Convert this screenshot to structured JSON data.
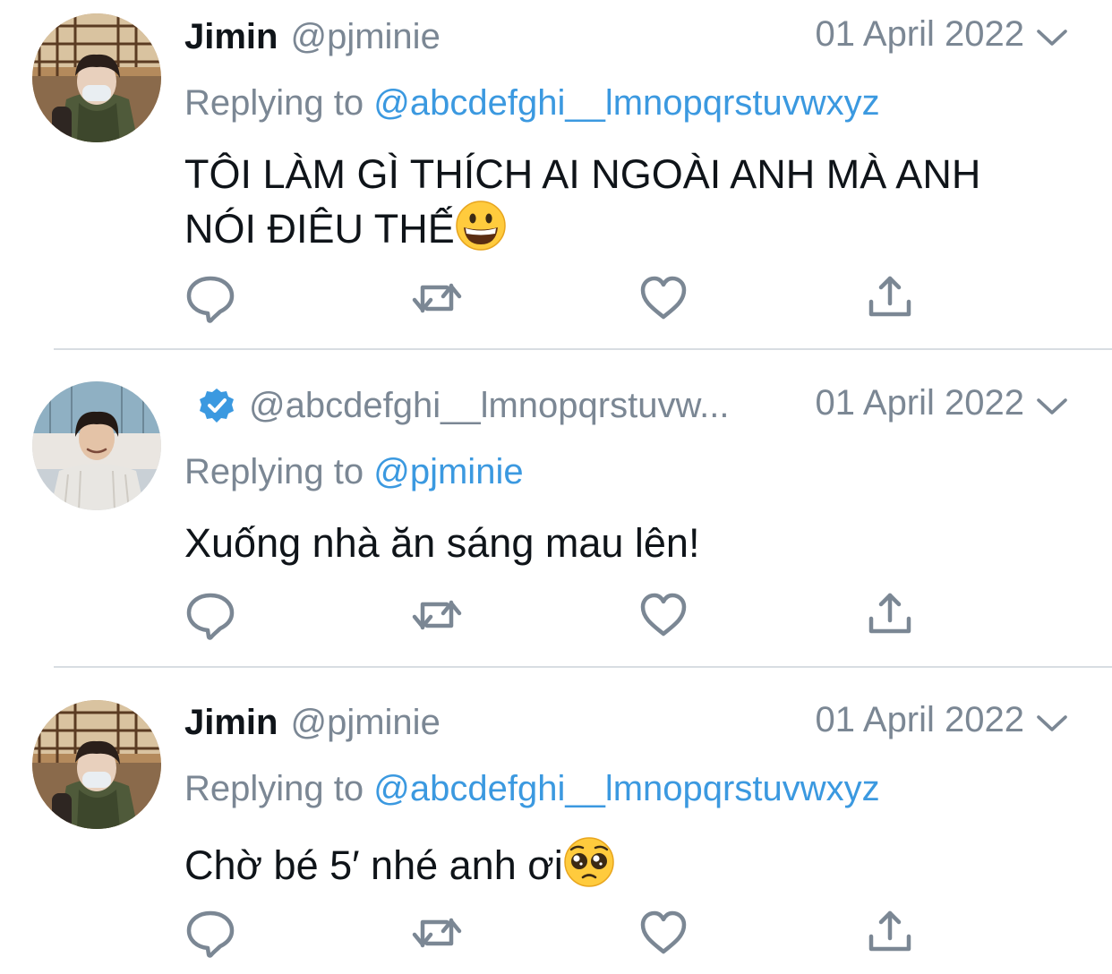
{
  "colors": {
    "text": "#0f1419",
    "secondary": "#7b8794",
    "link": "#3b99e0",
    "verified": "#3b99e0",
    "divider": "#d8dde2"
  },
  "tweets": [
    {
      "display_name": "Jimin",
      "handle": "@pjminie",
      "date": "01 April 2022",
      "replying_prefix": "Replying to",
      "replying_to": "@abcdefghi__lmnopqrstuvwxyz",
      "text": "TÔI LÀM GÌ THÍCH AI NGOÀI ANH MÀ ANH NÓI ĐIÊU THẾ",
      "emoji": "grinning-face",
      "avatar": "jimin-avatar"
    },
    {
      "display_name": "",
      "verified": true,
      "handle": "@abcdefghi__lmnopqrstuvw...",
      "date": "01 April 2022",
      "replying_prefix": "Replying to",
      "replying_to": "@pjminie",
      "text": "Xuống nhà ăn sáng mau lên!",
      "avatar": "second-user-avatar"
    },
    {
      "display_name": "Jimin",
      "handle": "@pjminie",
      "date": "01 April 2022",
      "replying_prefix": "Replying to",
      "replying_to": "@abcdefghi__lmnopqrstuvwxyz",
      "text": "Chờ bé 5′ nhé anh ơi",
      "emoji": "pleading-face",
      "avatar": "jimin-avatar"
    }
  ],
  "icons": {
    "reply": "reply-icon",
    "retweet": "retweet-icon",
    "like": "like-icon",
    "share": "share-icon",
    "more": "chevron-down-icon",
    "verified": "verified-badge-icon"
  }
}
